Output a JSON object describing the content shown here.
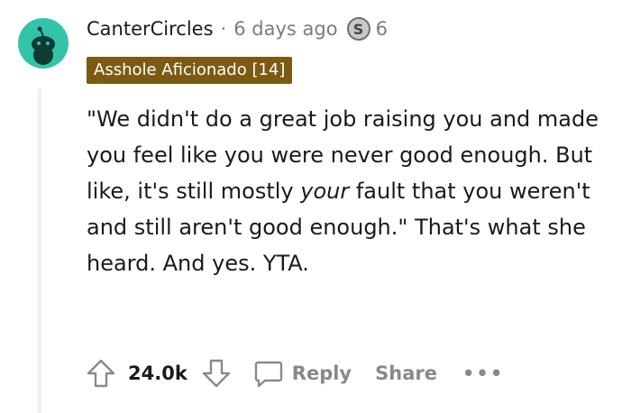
{
  "comment": {
    "author": "CanterCircles",
    "separator": "·",
    "time": "6 days ago",
    "award": {
      "icon": "silver-award-icon",
      "glyph": "S",
      "count": "6"
    },
    "flair": "Asshole Aficionado [14]",
    "body": {
      "part1": "\"We didn't do a great job raising you and made you feel like you were never good enough. But like, it's still mostly ",
      "emphasis": "your",
      "part2": " fault that you weren't and still aren't good enough.\" That's what she heard. And yes. YTA."
    },
    "score": "24.0k",
    "reply_label": "Reply",
    "share_label": "Share",
    "more_label": "•••"
  },
  "colors": {
    "avatar_bg": "#33c3a9",
    "flair_bg": "#7c5a12",
    "muted": "#878a8c"
  }
}
